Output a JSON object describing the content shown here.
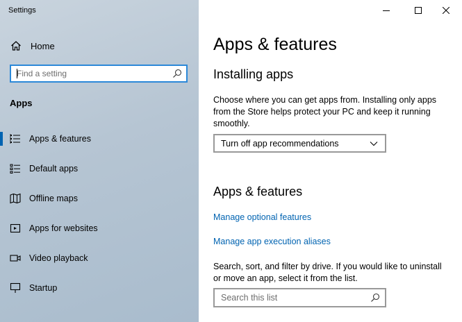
{
  "window": {
    "title": "Settings",
    "controls": {
      "minimize_icon": "minimize-icon",
      "maximize_icon": "maximize-icon",
      "close_icon": "close-icon"
    }
  },
  "sidebar": {
    "home_label": "Home",
    "search_placeholder": "Find a setting",
    "section_title": "Apps",
    "accent_color": "#0063b1",
    "items": [
      {
        "label": "Apps & features",
        "icon": "apps-features-icon",
        "active": true
      },
      {
        "label": "Default apps",
        "icon": "default-apps-icon"
      },
      {
        "label": "Offline maps",
        "icon": "offline-maps-icon"
      },
      {
        "label": "Apps for websites",
        "icon": "apps-for-websites-icon"
      },
      {
        "label": "Video playback",
        "icon": "video-playback-icon"
      },
      {
        "label": "Startup",
        "icon": "startup-icon"
      }
    ]
  },
  "main": {
    "page_title": "Apps & features",
    "installing": {
      "title": "Installing apps",
      "description": "Choose where you can get apps from. Installing only apps from the Store helps protect your PC and keep it running smoothly.",
      "dropdown_value": "Turn off app recommendations"
    },
    "features": {
      "title": "Apps & features",
      "link_optional": "Manage optional features",
      "link_aliases": "Manage app execution aliases",
      "description": "Search, sort, and filter by drive. If you would like to uninstall or move an app, select it from the list.",
      "search_placeholder": "Search this list"
    },
    "link_color": "#0063b1"
  }
}
